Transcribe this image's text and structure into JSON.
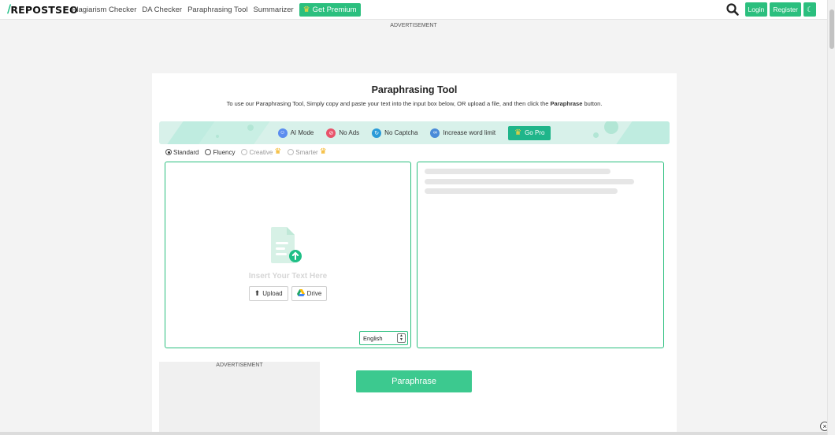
{
  "header": {
    "logo": "REPOSTSEO",
    "logo_mark": "/",
    "nav": [
      "Plagiarism Checker",
      "DA Checker",
      "Paraphrasing Tool",
      "Summarizer"
    ],
    "premium_label": "Get Premium",
    "login_label": "Login",
    "register_label": "Register",
    "icons": [
      "search-icon",
      "crown-icon",
      "moon-icon"
    ]
  },
  "ads": {
    "top_label": "ADVERTISEMENT",
    "side_label": "ADVERTISEMENT",
    "close": "×"
  },
  "card": {
    "title": "Paraphrasing Tool",
    "subtitle_pre": "To use our Paraphrasing Tool, Simply copy and paste your text into the input box below, OR upload a file, and then click the ",
    "subtitle_bold": "Paraphrase",
    "subtitle_post": " button."
  },
  "banner": {
    "features": [
      {
        "label": "AI Mode",
        "icon": "ai-mode-icon",
        "color": "#5b8def"
      },
      {
        "label": "No Ads",
        "icon": "no-ads-icon",
        "color": "#e8536a"
      },
      {
        "label": "No Captcha",
        "icon": "no-captcha-icon",
        "color": "#2a9bd8"
      },
      {
        "label": "Increase word limit",
        "icon": "infinity-icon",
        "color": "#4a8ad8"
      }
    ],
    "gopro_label": "Go Pro"
  },
  "modes": [
    {
      "label": "Standard",
      "selected": true,
      "premium": false
    },
    {
      "label": "Fluency",
      "selected": false,
      "premium": false
    },
    {
      "label": "Creative",
      "selected": false,
      "premium": true
    },
    {
      "label": "Smarter",
      "selected": false,
      "premium": true
    }
  ],
  "input": {
    "placeholder": "Insert Your Text Here",
    "upload_label": "Upload",
    "drive_label": "Drive",
    "language": "English"
  },
  "action": {
    "paraphrase_label": "Paraphrase"
  },
  "colors": {
    "accent": "#2bbf7e",
    "banner_bg": "#d8f1ea",
    "gopro": "#1fb58a"
  }
}
